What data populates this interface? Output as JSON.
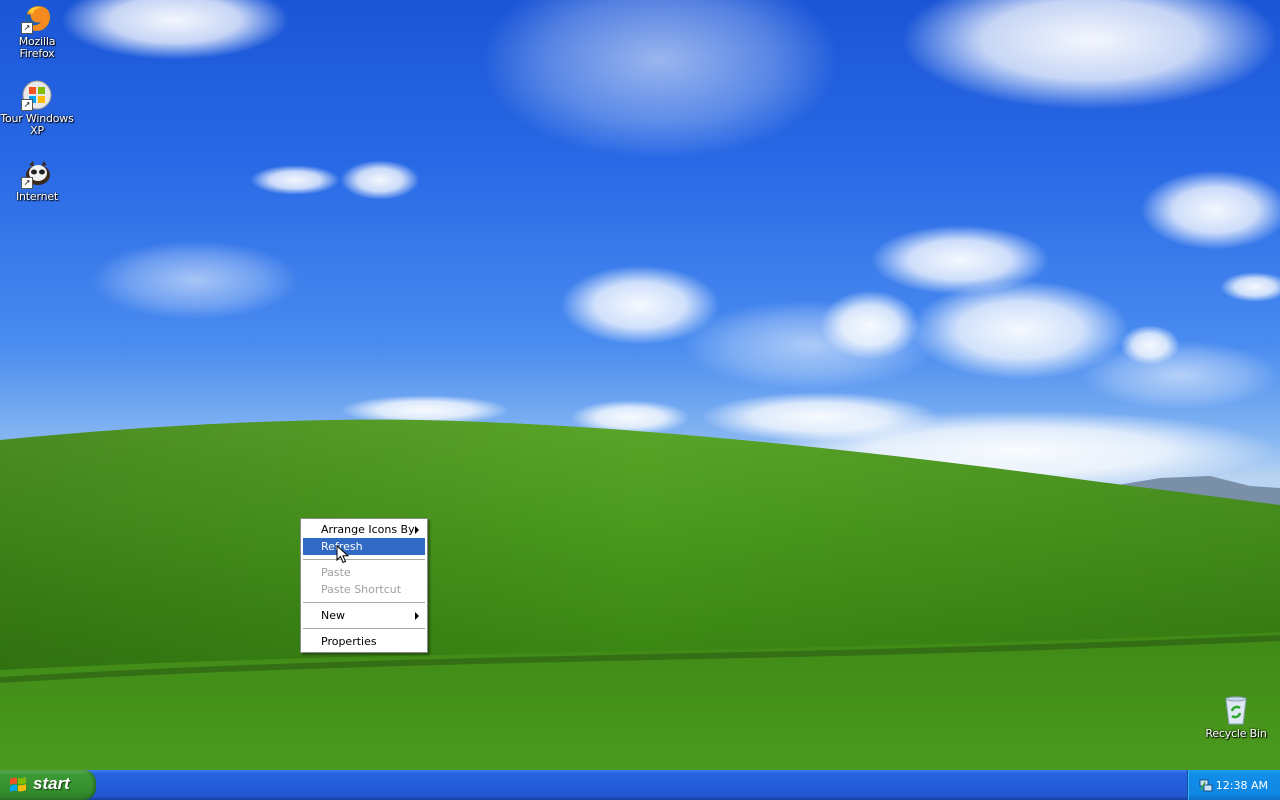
{
  "desktop": {
    "icons": [
      {
        "label": "Mozilla Firefox",
        "icon": "firefox-icon"
      },
      {
        "label": "Tour Windows XP",
        "icon": "tour-xp-icon"
      },
      {
        "label": "Internet",
        "icon": "internet-icon"
      },
      {
        "label": "Recycle Bin",
        "icon": "recycle-bin-icon"
      }
    ]
  },
  "context_menu": {
    "items": [
      {
        "label": "Arrange Icons By",
        "submenu": true,
        "enabled": true
      },
      {
        "label": "Refresh",
        "enabled": true,
        "highlighted": true
      },
      {
        "label": "Paste",
        "enabled": false
      },
      {
        "label": "Paste Shortcut",
        "enabled": false
      },
      {
        "label": "New",
        "submenu": true,
        "enabled": true
      },
      {
        "label": "Properties",
        "enabled": true
      }
    ]
  },
  "taskbar": {
    "start_label": "start",
    "clock": "12:38 AM",
    "tray_icon": "network-connection-icon"
  },
  "colors": {
    "taskbar_blue": "#245edb",
    "start_green": "#35922f",
    "menu_highlight": "#316ac5",
    "tray_blue": "#0f87e3"
  }
}
